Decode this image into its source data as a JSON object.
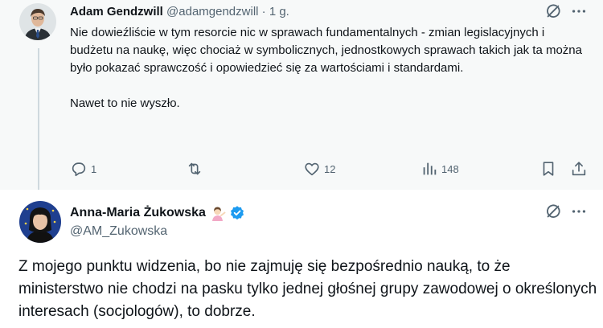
{
  "reply": {
    "author_name": "Adam Gendzwill",
    "author_handle": "@adamgendzwill",
    "separator": "·",
    "time": "1 g.",
    "more_label": "···",
    "paragraphs": [
      "Nie dowieźliście w tym resorcie nic w sprawach fundamentalnych - zmian legislacyjnych i budżetu na naukę, więc chociaż w symbolicznych, jednostkowych sprawach takich jak ta można było pokazać sprawczość i opowiedzieć się za wartościami i standardami.",
      "Nawet to nie wyszło."
    ],
    "actions": {
      "replies": "1",
      "reposts": "",
      "likes": "12",
      "views": "148"
    }
  },
  "main": {
    "author_name": "Anna-Maria Żukowska",
    "author_handle": "@AM_Zukowska",
    "more_label": "···",
    "text": "Z mojego punktu widzenia, bo nie zajmuję się bezpośrednio nauką, to że ministerstwo nie chodzi na pasku tylko jednej głośnej grupy zawodowej o określonych interesach (socjologów), to dobrze."
  },
  "colors": {
    "muted": "#536471",
    "verified": "#1d9bf0",
    "thread_line": "#cfd9de",
    "reply_background": "#f7f9f9"
  },
  "icons": [
    "grok-icon",
    "more-icon",
    "reply-icon",
    "repost-icon",
    "like-icon",
    "views-icon",
    "bookmark-icon",
    "share-icon",
    "verified-badge-icon",
    "emoji-icon"
  ]
}
